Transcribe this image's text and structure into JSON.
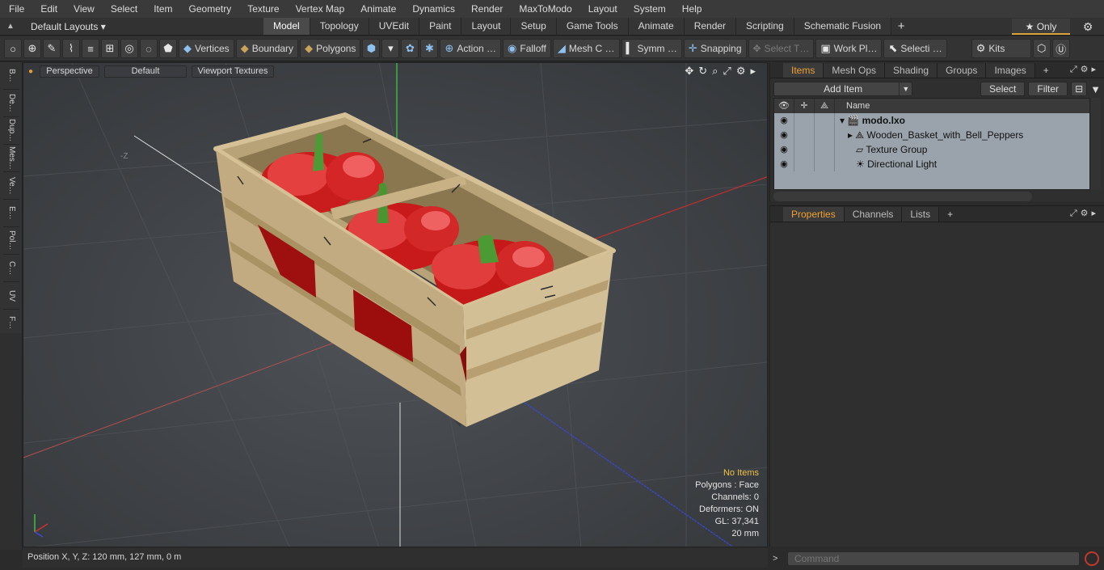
{
  "menu": [
    "File",
    "Edit",
    "View",
    "Select",
    "Item",
    "Geometry",
    "Texture",
    "Vertex Map",
    "Animate",
    "Dynamics",
    "Render",
    "MaxToModo",
    "Layout",
    "System",
    "Help"
  ],
  "layout": {
    "selector": "Default Layouts ▾",
    "tabs": [
      "Model",
      "Topology",
      "UVEdit",
      "Paint",
      "Layout",
      "Setup",
      "Game Tools",
      "Animate",
      "Render",
      "Scripting",
      "Schematic Fusion"
    ],
    "active_tab": "Model",
    "only_label": "★  Only"
  },
  "toolbar": {
    "vertices": "Vertices",
    "boundary": "Boundary",
    "polygons": "Polygons",
    "action": "Action  …",
    "falloff": "Falloff",
    "mesh": "Mesh C …",
    "symm": "Symm …",
    "snapping": "Snapping",
    "select_t": "Select T…",
    "work_pl": "Work Pl…",
    "selecti": "Selecti …",
    "kits": "Kits"
  },
  "left_strip": [
    "B…",
    "De…",
    "Dup…",
    "Mes…",
    "Ve…",
    "E…",
    "Pol…",
    "C…",
    "UV",
    "F…"
  ],
  "viewport": {
    "view_mode": "Perspective",
    "shading": "Default",
    "textures": "Viewport Textures",
    "neg_z_label": "-Z",
    "info": {
      "selection": "No Items",
      "polygons": "Polygons : Face",
      "channels": "Channels: 0",
      "deformers": "Deformers: ON",
      "gl": "GL: 37,341",
      "scale": "20 mm"
    }
  },
  "status": {
    "position": "Position X, Y, Z:   120 mm, 127 mm, 0 m"
  },
  "items_panel": {
    "tabs": [
      "Items",
      "Mesh Ops",
      "Shading",
      "Groups",
      "Images"
    ],
    "active_tab": "Items",
    "add_item": "Add Item",
    "select_btn": "Select",
    "filter_btn": "Filter",
    "name_header": "Name",
    "rows": [
      {
        "name": "modo.lxo",
        "bold": true
      },
      {
        "name": "Wooden_Basket_with_Bell_Peppers"
      },
      {
        "name": "Texture Group"
      },
      {
        "name": "Directional Light"
      }
    ]
  },
  "props_panel": {
    "tabs": [
      "Properties",
      "Channels",
      "Lists"
    ],
    "active_tab": "Properties"
  },
  "command": {
    "placeholder": "Command"
  },
  "colors": {
    "accent": "#f0a030",
    "x_axis": "#d03030",
    "y_axis": "#30d030",
    "z_axis": "#3040d0"
  }
}
